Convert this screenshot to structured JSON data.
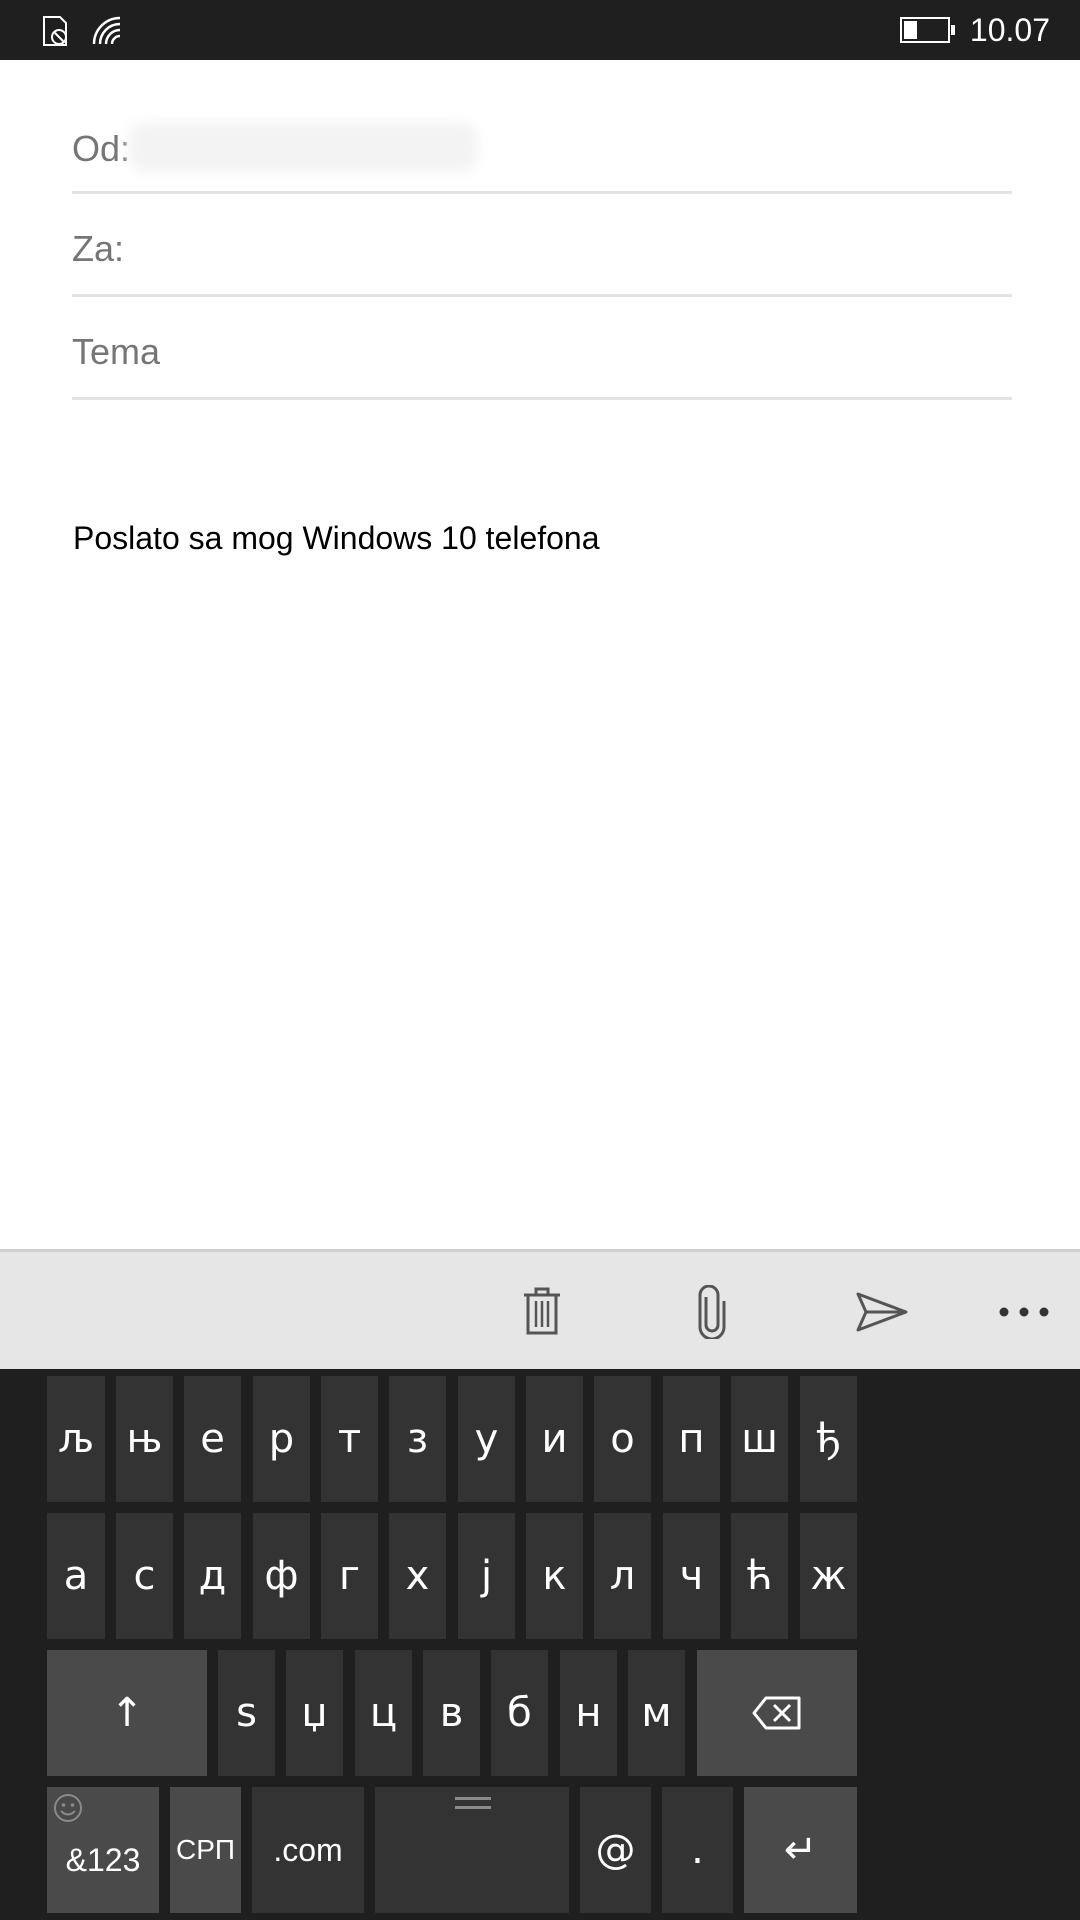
{
  "status_bar": {
    "time": "10.07",
    "battery_level": 0.3,
    "icons": [
      "no-sim-icon",
      "wifi-icon",
      "battery-icon"
    ]
  },
  "compose": {
    "from_label": "Od:",
    "to_label": "Za:",
    "subject_placeholder": "Tema",
    "body_signature": "Poslato sa mog Windows 10 telefona"
  },
  "app_bar": {
    "buttons": [
      "trash-icon",
      "paperclip-icon",
      "send-icon",
      "more-icon"
    ]
  },
  "keyboard": {
    "row1": [
      "љ",
      "њ",
      "е",
      "р",
      "т",
      "з",
      "у",
      "и",
      "о",
      "п",
      "ш",
      "ђ"
    ],
    "row2": [
      "а",
      "с",
      "д",
      "ф",
      "г",
      "х",
      "ј",
      "к",
      "л",
      "ч",
      "ћ",
      "ж"
    ],
    "row3": [
      "s",
      "џ",
      "ц",
      "в",
      "б",
      "н",
      "м"
    ],
    "shift_symbol": "↑",
    "symbols_label": "&123",
    "language_label": "СРП",
    "dotcom_label": ".com",
    "at_label": "@",
    "period_label": ".",
    "enter_symbol": "↵"
  },
  "colors": {
    "status_bar_bg": "#1f1f1f",
    "keyboard_bg": "#1f1f1f",
    "key_bg": "#333333",
    "key_function_bg": "#4a4a4a",
    "app_bar_bg": "#e6e6e6"
  }
}
